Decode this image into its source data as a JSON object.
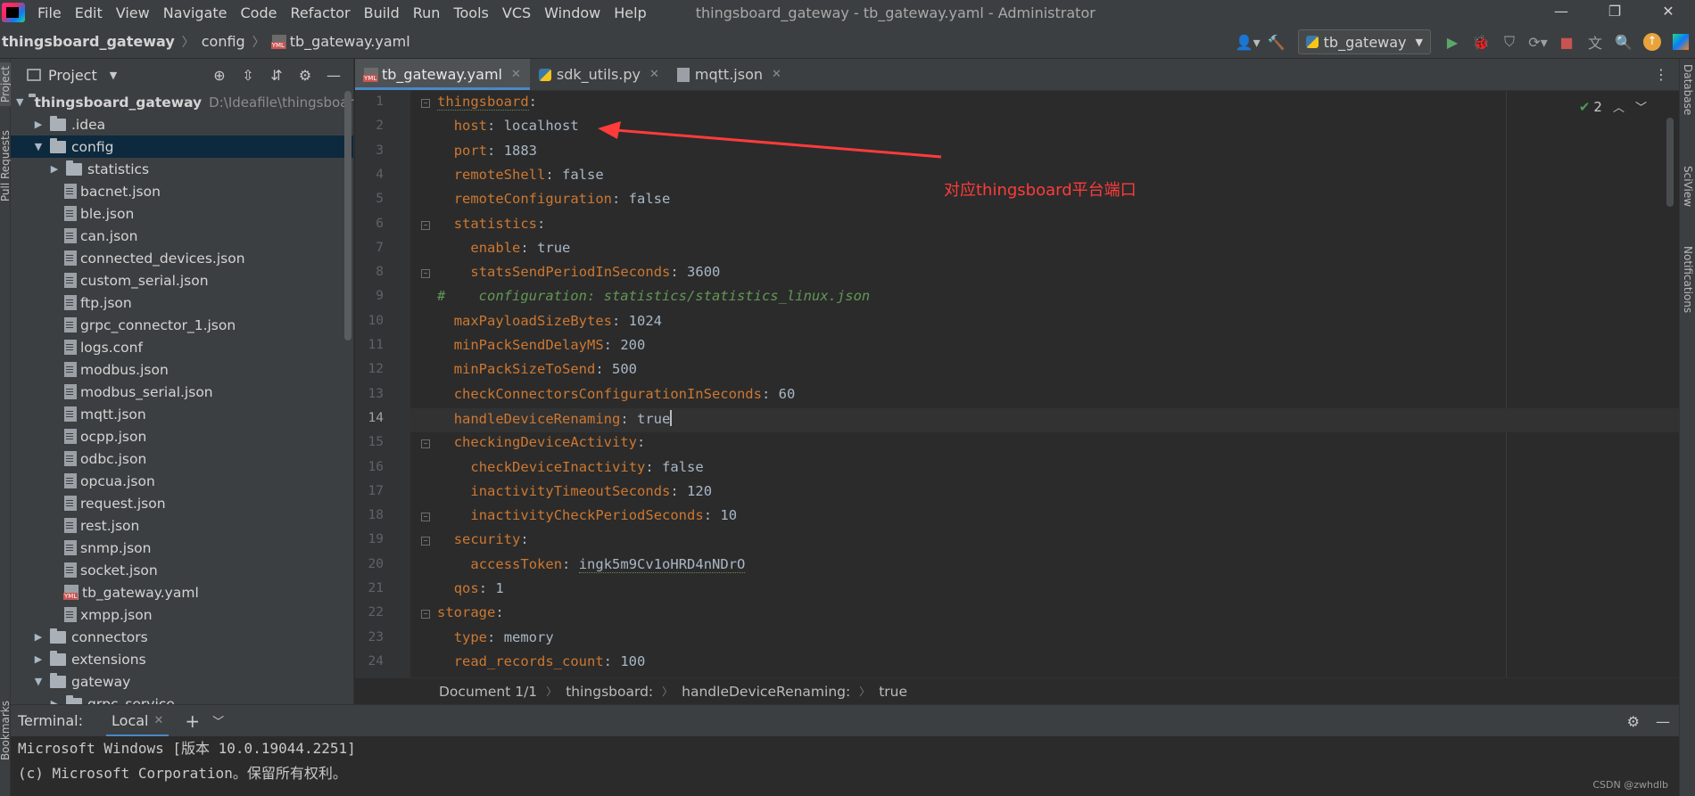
{
  "window": {
    "title": "thingsboard_gateway - tb_gateway.yaml - Administrator",
    "controls": [
      "—",
      "❐",
      "✕"
    ]
  },
  "menu": [
    "File",
    "Edit",
    "View",
    "Navigate",
    "Code",
    "Refactor",
    "Build",
    "Run",
    "Tools",
    "VCS",
    "Window",
    "Help"
  ],
  "breadcrumb": [
    "thingsboard_gateway",
    "config",
    "tb_gateway.yaml"
  ],
  "run_config": "tb_gateway",
  "project_panel": {
    "title": "Project",
    "root": "thingsboard_gateway",
    "root_path": "D:\\Ideafile\\thingsboar",
    "items": [
      {
        "label": ".idea",
        "type": "folder",
        "level": 1,
        "expanded": false
      },
      {
        "label": "config",
        "type": "folder",
        "level": 1,
        "expanded": true,
        "selected": true
      },
      {
        "label": "statistics",
        "type": "folder",
        "level": 2,
        "expanded": false
      },
      {
        "label": "bacnet.json",
        "type": "file",
        "level": 2
      },
      {
        "label": "ble.json",
        "type": "file",
        "level": 2
      },
      {
        "label": "can.json",
        "type": "file",
        "level": 2
      },
      {
        "label": "connected_devices.json",
        "type": "file",
        "level": 2
      },
      {
        "label": "custom_serial.json",
        "type": "file",
        "level": 2
      },
      {
        "label": "ftp.json",
        "type": "file",
        "level": 2
      },
      {
        "label": "grpc_connector_1.json",
        "type": "file",
        "level": 2
      },
      {
        "label": "logs.conf",
        "type": "file",
        "level": 2
      },
      {
        "label": "modbus.json",
        "type": "file",
        "level": 2
      },
      {
        "label": "modbus_serial.json",
        "type": "file",
        "level": 2
      },
      {
        "label": "mqtt.json",
        "type": "file",
        "level": 2
      },
      {
        "label": "ocpp.json",
        "type": "file",
        "level": 2
      },
      {
        "label": "odbc.json",
        "type": "file",
        "level": 2
      },
      {
        "label": "opcua.json",
        "type": "file",
        "level": 2
      },
      {
        "label": "request.json",
        "type": "file",
        "level": 2
      },
      {
        "label": "rest.json",
        "type": "file",
        "level": 2
      },
      {
        "label": "snmp.json",
        "type": "file",
        "level": 2
      },
      {
        "label": "socket.json",
        "type": "file",
        "level": 2
      },
      {
        "label": "tb_gateway.yaml",
        "type": "yaml",
        "level": 2
      },
      {
        "label": "xmpp.json",
        "type": "file",
        "level": 2
      },
      {
        "label": "connectors",
        "type": "folder",
        "level": 1,
        "expanded": false
      },
      {
        "label": "extensions",
        "type": "folder",
        "level": 1,
        "expanded": false
      },
      {
        "label": "gateway",
        "type": "folder",
        "level": 1,
        "expanded": true
      },
      {
        "label": "grpc_service",
        "type": "folder",
        "level": 2,
        "expanded": false
      }
    ]
  },
  "tabs": [
    {
      "label": "tb_gateway.yaml",
      "active": true,
      "icon": "yaml-icon"
    },
    {
      "label": "sdk_utils.py",
      "active": false,
      "icon": "python-icon"
    },
    {
      "label": "mqtt.json",
      "active": false,
      "icon": "json-icon"
    }
  ],
  "editor": {
    "current_line": 14,
    "inspection_count": "2",
    "lines": [
      {
        "n": "1",
        "indent": 0,
        "key": "thingsboard",
        "sep": ":",
        "val": ""
      },
      {
        "n": "2",
        "indent": 1,
        "key": "host",
        "sep": ": ",
        "val": "localhost"
      },
      {
        "n": "3",
        "indent": 1,
        "key": "port",
        "sep": ": ",
        "val": "1883"
      },
      {
        "n": "4",
        "indent": 1,
        "key": "remoteShell",
        "sep": ": ",
        "val": "false"
      },
      {
        "n": "5",
        "indent": 1,
        "key": "remoteConfiguration",
        "sep": ": ",
        "val": "false"
      },
      {
        "n": "6",
        "indent": 1,
        "key": "statistics",
        "sep": ":",
        "val": ""
      },
      {
        "n": "7",
        "indent": 2,
        "key": "enable",
        "sep": ": ",
        "val": "true"
      },
      {
        "n": "8",
        "indent": 2,
        "key": "statsSendPeriodInSeconds",
        "sep": ": ",
        "val": "3600"
      },
      {
        "n": "9",
        "indent": 0,
        "comment": "#    configuration: statistics/statistics_linux.json"
      },
      {
        "n": "10",
        "indent": 1,
        "key": "maxPayloadSizeBytes",
        "sep": ": ",
        "val": "1024"
      },
      {
        "n": "11",
        "indent": 1,
        "key": "minPackSendDelayMS",
        "sep": ": ",
        "val": "200"
      },
      {
        "n": "12",
        "indent": 1,
        "key": "minPackSizeToSend",
        "sep": ": ",
        "val": "500"
      },
      {
        "n": "13",
        "indent": 1,
        "key": "checkConnectorsConfigurationInSeconds",
        "sep": ": ",
        "val": "60"
      },
      {
        "n": "14",
        "indent": 1,
        "key": "handleDeviceRenaming",
        "sep": ": ",
        "val": "true"
      },
      {
        "n": "15",
        "indent": 1,
        "key": "checkingDeviceActivity",
        "sep": ":",
        "val": ""
      },
      {
        "n": "16",
        "indent": 2,
        "key": "checkDeviceInactivity",
        "sep": ": ",
        "val": "false"
      },
      {
        "n": "17",
        "indent": 2,
        "key": "inactivityTimeoutSeconds",
        "sep": ": ",
        "val": "120"
      },
      {
        "n": "18",
        "indent": 2,
        "key": "inactivityCheckPeriodSeconds",
        "sep": ": ",
        "val": "10"
      },
      {
        "n": "19",
        "indent": 1,
        "key": "security",
        "sep": ":",
        "val": ""
      },
      {
        "n": "20",
        "indent": 2,
        "key": "accessToken",
        "sep": ": ",
        "val": "ingk5m9Cv1oHRD4nNDrO"
      },
      {
        "n": "21",
        "indent": 1,
        "key": "qos",
        "sep": ": ",
        "val": "1"
      },
      {
        "n": "22",
        "indent": 0,
        "key": "storage",
        "sep": ":",
        "val": ""
      },
      {
        "n": "23",
        "indent": 1,
        "key": "type",
        "sep": ": ",
        "val": "memory"
      },
      {
        "n": "24",
        "indent": 1,
        "key": "read_records_count",
        "sep": ": ",
        "val": "100"
      }
    ]
  },
  "annotation": {
    "text": "对应thingsboard平台端口",
    "color": "#ff3b3b"
  },
  "editor_breadcrumbs": [
    "Document 1/1",
    "thingsboard:",
    "handleDeviceRenaming:",
    "true"
  ],
  "terminal": {
    "label": "Terminal:",
    "tab": "Local",
    "lines": [
      "Microsoft Windows [版本 10.0.19044.2251]",
      "(c) Microsoft Corporation。保留所有权利。"
    ]
  },
  "side_tools": {
    "left": [
      "Project",
      "Pull Requests",
      "Bookmarks"
    ],
    "right": [
      "Database",
      "SciView",
      "Notifications"
    ]
  },
  "watermark": "CSDN @zwhdlb",
  "colors": {
    "accent": "#4a88c7",
    "selection": "#0d293e",
    "yaml_key": "#cc7832",
    "comment": "#629755"
  }
}
